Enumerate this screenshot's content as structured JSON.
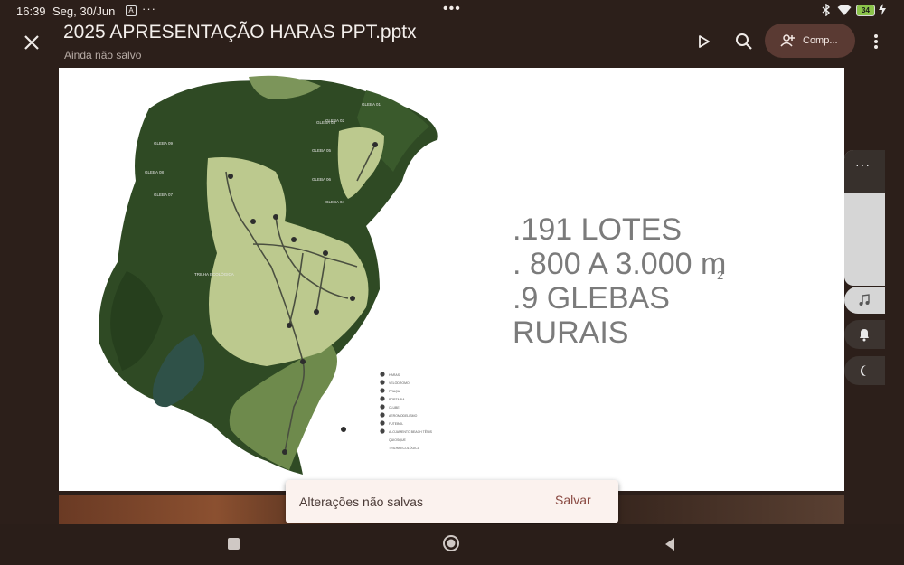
{
  "status": {
    "time": "16:39",
    "date": "Seg, 30/Jun",
    "overflow": "···",
    "center_dots": "•••",
    "battery": "34",
    "icons": [
      "notification-icon",
      "bluetooth-icon",
      "wifi-icon",
      "battery-icon",
      "charging-icon"
    ]
  },
  "header": {
    "title": "2025 APRESENTAÇÃO HARAS PPT.pptx",
    "subtitle": "Ainda não salvo",
    "share_label": "Comp...",
    "icons": [
      "close-icon",
      "play-icon",
      "search-icon",
      "person-add-icon",
      "more-vert-icon"
    ]
  },
  "slide": {
    "lines": [
      ".191 LOTES",
      ". 800 A 3.000 m",
      ".9 GLEBAS",
      "RURAIS"
    ],
    "superscript": "2",
    "text_color": "#7b7b7b",
    "map": {
      "glebas": [
        "GLEBA 09",
        "GLEBA 08",
        "GLEBA 07",
        "GLEBA 06",
        "GLEBA 05",
        "GLEBA 04",
        "GLEBA 03",
        "GLEBA 02",
        "GLEBA 01"
      ],
      "trail_label": "TRILHA ECOLÓGICA",
      "legend": [
        {
          "num": "01",
          "label": "HARAS"
        },
        {
          "num": "02",
          "label": "VELÓDROMO"
        },
        {
          "num": "03",
          "label": "PRAÇA"
        },
        {
          "num": "04",
          "label": "PORTARIA"
        },
        {
          "num": "05",
          "label": "CLUBE"
        },
        {
          "num": "06",
          "label": "AEROMODELISMO"
        },
        {
          "num": "07",
          "label": "FUTEBOL"
        },
        {
          "num": "08",
          "label": "ALOJAMENTO BEACH TÊNIS"
        },
        {
          "num": "",
          "label": "QUIOSQUE"
        },
        {
          "num": "",
          "label": "TRILHA ECOLÓGICA"
        }
      ]
    }
  },
  "side_panel": {
    "more": "···",
    "icons": [
      "music-note-icon",
      "bell-icon",
      "moon-icon"
    ]
  },
  "snackbar": {
    "message": "Alterações não salvas",
    "action": "Salvar"
  },
  "navbar": {
    "icons": [
      "recent-apps-icon",
      "home-icon",
      "back-icon"
    ]
  },
  "colors": {
    "background": "#2c1f1a",
    "share_button": "#5a3a33",
    "forest": "#2e4a22",
    "lots": "#bcc98e"
  }
}
